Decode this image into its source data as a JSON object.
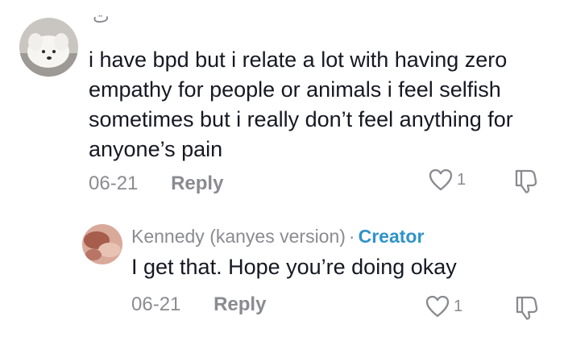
{
  "comment": {
    "username": "ت",
    "text": "i have bpd but i relate a lot with having zero empathy for people or animals i feel selfish sometimes but i really don’t feel anything for anyone’s pain",
    "date": "06-21",
    "reply_label": "Reply",
    "like_count": "1",
    "like_icon": "heart-outline",
    "dislike_icon": "thumbs-down-outline",
    "avatar_desc": "white-dog"
  },
  "reply": {
    "username": "Kennedy (kanyes version)",
    "separator": "·",
    "badge": "Creator",
    "text": "I get that. Hope you’re doing okay",
    "date": "06-21",
    "reply_label": "Reply",
    "like_count": "1",
    "like_icon": "heart-outline",
    "dislike_icon": "thumbs-down-outline"
  },
  "colors": {
    "text": "#161823",
    "muted": "#8a8b91",
    "creator_badge": "#2f93c9"
  }
}
